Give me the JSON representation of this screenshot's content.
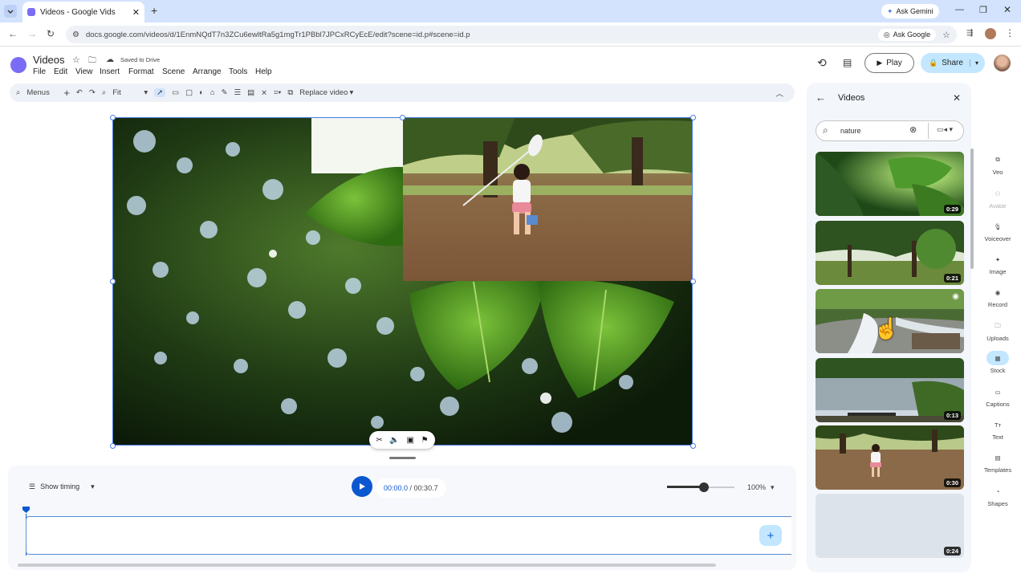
{
  "browser": {
    "tab_title": "Videos - Google Vids",
    "url": "docs.google.com/videos/d/1EnmNQdT7n3ZCu6ewltRa5g1mgTr1PBbl7JPCxRCyEcE/edit?scene=id.p#scene=id.p",
    "ask_gemini": "Ask Gemini",
    "ask_google": "Ask Google"
  },
  "app": {
    "title": "Videos",
    "saved_status": "Saved to Drive",
    "menus": [
      "File",
      "Edit",
      "View",
      "Insert",
      "Format",
      "Scene",
      "Arrange",
      "Tools",
      "Help"
    ],
    "play_label": "Play",
    "share_label": "Share"
  },
  "toolbar": {
    "menus_label": "Menus",
    "zoom_value": "Fit",
    "replace_video": "Replace video"
  },
  "timeline": {
    "show_timing": "Show timing",
    "current_time": "00:00.0",
    "separator": " / ",
    "total_time": "00:30.7",
    "zoom": "100%",
    "zoom_slider_level": 0.55
  },
  "panel": {
    "title": "Videos",
    "search_value": "nature",
    "thumbnails": [
      {
        "duration": "0:29"
      },
      {
        "duration": "0:21"
      },
      {
        "duration": ""
      },
      {
        "duration": "0:13"
      },
      {
        "duration": "0:30"
      },
      {
        "duration": "0:24"
      }
    ]
  },
  "rail": [
    {
      "label": "Veo",
      "icon": "veo-icon"
    },
    {
      "label": "Avatar",
      "icon": "avatar-icon",
      "disabled": true
    },
    {
      "label": "Voiceover",
      "icon": "voiceover-icon"
    },
    {
      "label": "Image",
      "icon": "image-icon"
    },
    {
      "label": "Record",
      "icon": "record-icon"
    },
    {
      "label": "Uploads",
      "icon": "folder-icon"
    },
    {
      "label": "Stock",
      "icon": "stock-icon",
      "active": true
    },
    {
      "label": "Captions",
      "icon": "captions-icon"
    },
    {
      "label": "Text",
      "icon": "text-icon"
    },
    {
      "label": "Templates",
      "icon": "templates-icon"
    },
    {
      "label": "Shapes",
      "icon": "shapes-icon"
    }
  ],
  "colors": {
    "accent": "#0b57d0",
    "tabbar": "#d3e3fd",
    "share": "#c2e7ff"
  }
}
